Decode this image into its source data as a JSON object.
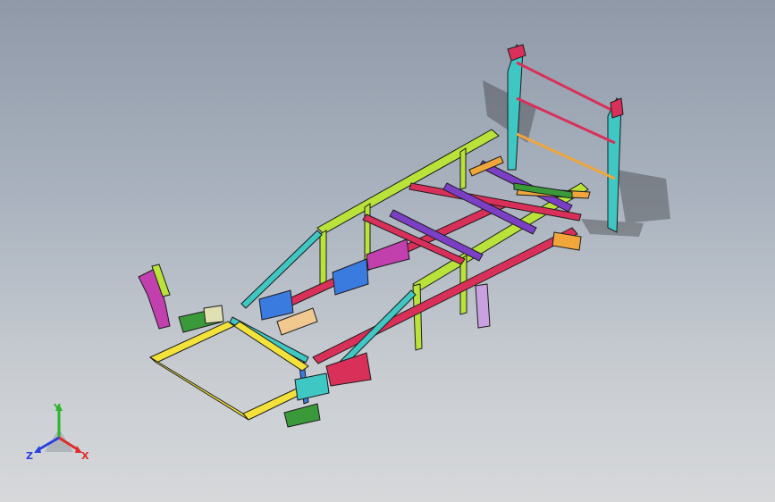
{
  "viewport": {
    "background_top": "#8f99a8",
    "background_bottom": "#d6d8da"
  },
  "model": {
    "name_visible": "",
    "part_colors": {
      "frame_green": "#b9e23a",
      "frame_cyan": "#3fc7c4",
      "frame_red": "#d9305a",
      "frame_purple": "#7b3fc6",
      "frame_yellow": "#f2e23a",
      "frame_blue": "#3a7be0",
      "frame_orange": "#f0a63a",
      "frame_magenta": "#c23fae",
      "edge": "#1c1c1c"
    }
  },
  "triad": {
    "x_label": "X",
    "y_label": "Y",
    "z_label": "Z",
    "x_color": "#e02b2b",
    "y_color": "#2bb52b",
    "z_color": "#2b3fe0"
  }
}
